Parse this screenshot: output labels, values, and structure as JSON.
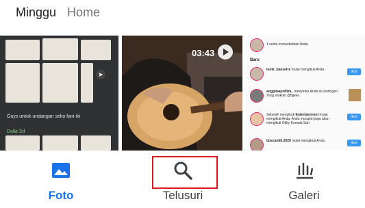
{
  "header": {
    "title": "Minggu",
    "subtitle": "Home"
  },
  "grid": {
    "item1": {
      "caption": "Guys untuk undangan seko fani iki",
      "link": "Dalla Sd"
    },
    "item2": {
      "duration": "03:43"
    },
    "item3": {
      "top_text": "1 cerita menyebutkan Anda",
      "section": "Baru",
      "rows": [
        {
          "user": "tovik_bansetre",
          "text": "mulai mengikuti Anda",
          "action": "Ikuti"
        },
        {
          "user": "anggitaaprilliza_",
          "text": "menyebut Anda di postingan: Yang mokoin @fijjeev",
          "action": ""
        },
        {
          "user": "",
          "text": "Sebelah mengikuti",
          "action": ""
        },
        {
          "user": "Entertainment",
          "text": "mulai mengikuti Anda. Anda mungkin juga akan mengikuti Okky Kumala Sari",
          "action": "Ikuti"
        },
        {
          "user": "tipscantik.2020",
          "text": "mulai mengikuti Anda",
          "action": "Ikuti"
        }
      ]
    }
  },
  "nav": {
    "tabs": [
      {
        "label": "Foto",
        "icon": "photo-icon",
        "active": true
      },
      {
        "label": "Telusuri",
        "icon": "search-icon",
        "active": false
      },
      {
        "label": "Galeri",
        "icon": "library-icon",
        "active": false
      }
    ]
  },
  "colors": {
    "active": "#1a73e8",
    "highlight": "#e0161e",
    "follow": "#3897f0"
  }
}
